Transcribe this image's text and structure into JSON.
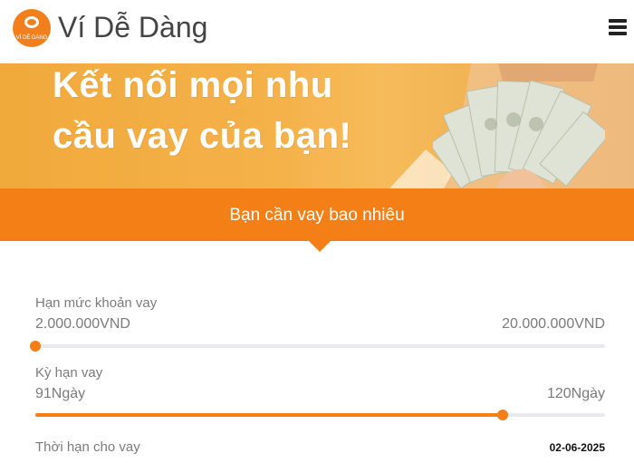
{
  "header": {
    "logo_text": "VÍ DỄ DÀNG",
    "brand": "Ví Dễ Dàng",
    "menu_icon": "hamburger-menu-icon"
  },
  "banner": {
    "line1": "Kết nối mọi nhu",
    "line2": "cầu vay của bạn!"
  },
  "section": {
    "title": "Bạn cần vay bao nhiêu"
  },
  "loan_amount": {
    "label": "Hạn mức khoản vay",
    "min": "2.000.000VND",
    "max": "20.000.000VND",
    "value_fraction": 0.0
  },
  "loan_term": {
    "label": "Kỳ hạn vay",
    "min": "91Ngày",
    "max": "120Ngày",
    "value_fraction": 0.82
  },
  "deadline": {
    "label": "Thời hạn cho vay",
    "date": "02-06-2025"
  },
  "colors": {
    "accent": "#f57f17",
    "track": "#e9e9ee"
  }
}
